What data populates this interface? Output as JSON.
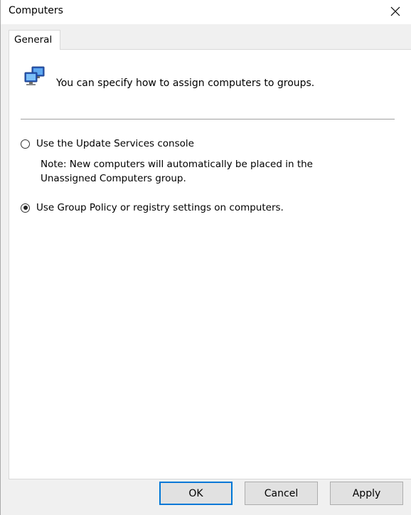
{
  "window": {
    "title": "Computers",
    "close_glyph": "close-icon"
  },
  "tabs": [
    {
      "label": "General",
      "selected": true
    }
  ],
  "panel": {
    "header_icon": "computers-icon",
    "header_text": "You can specify how to assign computers to groups.",
    "options": [
      {
        "label": "Use the Update Services console",
        "selected": false
      },
      {
        "label": "Use Group Policy or registry settings on computers.",
        "selected": true
      }
    ],
    "note_line1": "Note: New computers will automatically be placed in the",
    "note_line2": "Unassigned Computers group."
  },
  "buttons": {
    "ok": "OK",
    "cancel": "Cancel",
    "apply": "Apply"
  },
  "colors": {
    "accent": "#0078d7",
    "panel_bg": "#ffffff",
    "dialog_bg": "#f0f0f0"
  }
}
